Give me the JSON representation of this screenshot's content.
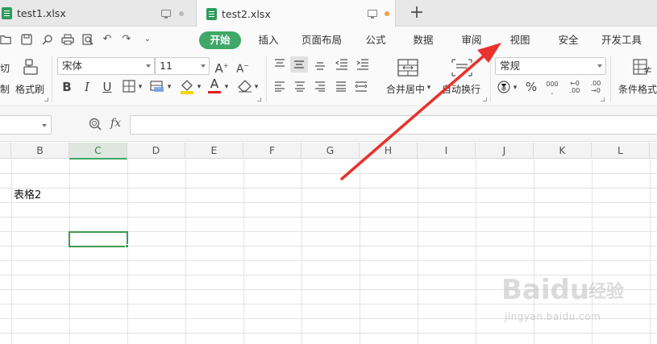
{
  "tabs": [
    {
      "name": "test1.xlsx",
      "active": false,
      "modified_dot_color": "#b9b9b9"
    },
    {
      "name": "test2.xlsx",
      "active": true,
      "modified_dot_color": "#f0a04b"
    }
  ],
  "new_tab_label": "+",
  "menu": {
    "tabs": [
      "开始",
      "插入",
      "页面布局",
      "公式",
      "数据",
      "审阅",
      "视图",
      "安全",
      "开发工具"
    ],
    "active": "开始"
  },
  "ribbon": {
    "cut_partial": "切",
    "copy_partial": "制",
    "format_painter": "格式刷",
    "font_name": "宋体",
    "font_size": "11",
    "bold": "B",
    "italic": "I",
    "underline": "U",
    "grow_font": "A⁺",
    "shrink_font": "A⁻",
    "merge_center": "合并居中",
    "wrap_text": "自动换行",
    "number_format": "常规",
    "percent": "%",
    "thousands": "000",
    "inc_decimal": "+0 .00",
    "dec_decimal": ".00 →0",
    "conditional_format": "条件格式",
    "font_color": "#e02020",
    "fill_color": "#f2d600"
  },
  "formula_bar": {
    "name_box": "",
    "fx": "fx",
    "formula": ""
  },
  "grid": {
    "columns": [
      "B",
      "C",
      "D",
      "E",
      "F",
      "G",
      "H",
      "I",
      "J",
      "K",
      "L"
    ],
    "active_column": "C",
    "cells": [
      {
        "col": "B",
        "row": 3,
        "value": "表格2"
      }
    ],
    "selected": {
      "col": "C",
      "row": 5
    }
  },
  "watermark": {
    "brand": "Baidu",
    "sub": "经验",
    "url": "jingyan.baidu.com"
  },
  "colors": {
    "accent": "#3fa867",
    "arrow": "#e8322b"
  }
}
